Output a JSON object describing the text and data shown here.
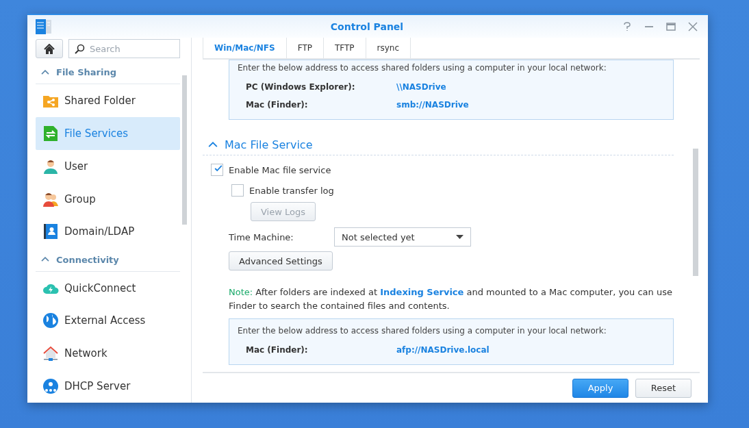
{
  "window": {
    "title": "Control Panel"
  },
  "sidebar": {
    "search": {
      "placeholder": "Search"
    },
    "groups": [
      {
        "title": "File Sharing",
        "expanded": true,
        "items": [
          {
            "label": "Shared Folder",
            "selected": false
          },
          {
            "label": "File Services",
            "selected": true
          },
          {
            "label": "User",
            "selected": false
          },
          {
            "label": "Group",
            "selected": false
          },
          {
            "label": "Domain/LDAP",
            "selected": false
          }
        ]
      },
      {
        "title": "Connectivity",
        "expanded": true,
        "items": [
          {
            "label": "QuickConnect",
            "selected": false
          },
          {
            "label": "External Access",
            "selected": false
          },
          {
            "label": "Network",
            "selected": false
          },
          {
            "label": "DHCP Server",
            "selected": false
          }
        ]
      }
    ]
  },
  "tabs": [
    {
      "label": "Win/Mac/NFS",
      "selected": true
    },
    {
      "label": "FTP",
      "selected": false
    },
    {
      "label": "TFTP",
      "selected": false
    },
    {
      "label": "rsync",
      "selected": false
    }
  ],
  "smb_box": {
    "intro": "Enter the below address to access shared folders using a computer in your local network:",
    "rows": [
      {
        "label": "PC (Windows Explorer):",
        "value": "\\\\NASDrive"
      },
      {
        "label": "Mac (Finder):",
        "value": "smb://NASDrive"
      }
    ]
  },
  "section": {
    "title": "Mac File Service",
    "expanded": true,
    "enable": {
      "label": "Enable Mac file service",
      "checked": true,
      "children": [
        {
          "kind": "checkbox",
          "label": "Enable transfer log",
          "checked": false
        },
        {
          "kind": "button",
          "label": "View Logs",
          "disabled": true
        }
      ]
    },
    "time_machine": {
      "label": "Time Machine:",
      "value": "Not selected yet"
    },
    "advanced_button": "Advanced Settings",
    "note": {
      "label": "Note:",
      "before": "After folders are indexed at",
      "link": "Indexing Service",
      "after": "and mounted to a Mac computer, you can use Finder to search the contained files and contents."
    },
    "afp_box": {
      "intro": "Enter the below address to access shared folders using a computer in your local network:",
      "rows": [
        {
          "label": "Mac (Finder):",
          "value": "afp://NASDrive.local"
        }
      ]
    }
  },
  "footer": {
    "buttons": [
      {
        "label": "Apply",
        "primary": true
      },
      {
        "label": "Reset",
        "primary": false
      }
    ]
  }
}
